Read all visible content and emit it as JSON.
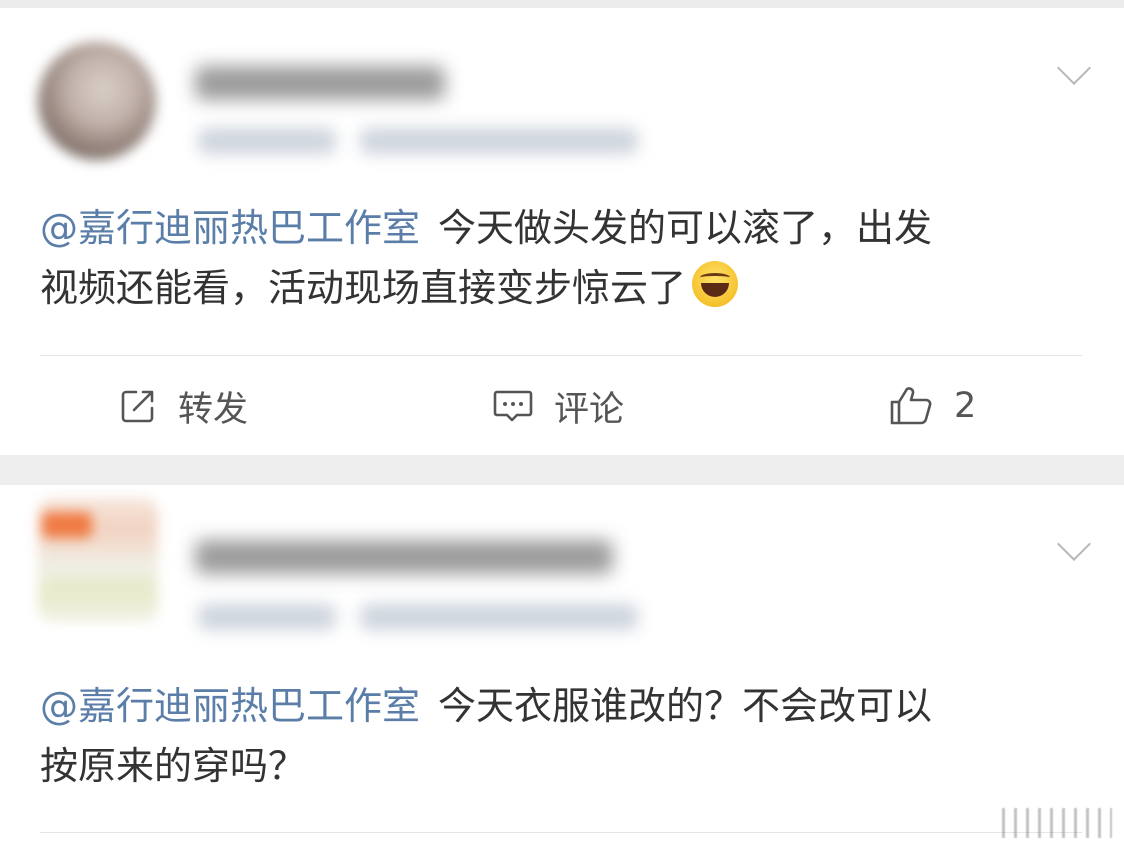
{
  "posts": [
    {
      "mention": "@嘉行迪丽热巴工作室",
      "text_line1": "今天做头发的可以滚了，出发",
      "text_line2": "视频还能看，活动现场直接变步惊云了",
      "emoji": "laughing-crying-emoji"
    },
    {
      "mention": "@嘉行迪丽热巴工作室",
      "text_line1": "今天衣服谁改的？不会改可以",
      "text_line2": "按原来的穿吗？"
    }
  ],
  "actions": {
    "repost_label": "转发",
    "comment_label": "评论",
    "like_count": "2"
  },
  "icons": {
    "repost": "repost-icon",
    "comment": "comment-icon",
    "like": "thumbs-up-icon",
    "more": "chevron-down-icon"
  },
  "colors": {
    "mention": "#5b7ea8",
    "text": "#333333",
    "action": "#555555",
    "background": "#f2f2f2"
  }
}
